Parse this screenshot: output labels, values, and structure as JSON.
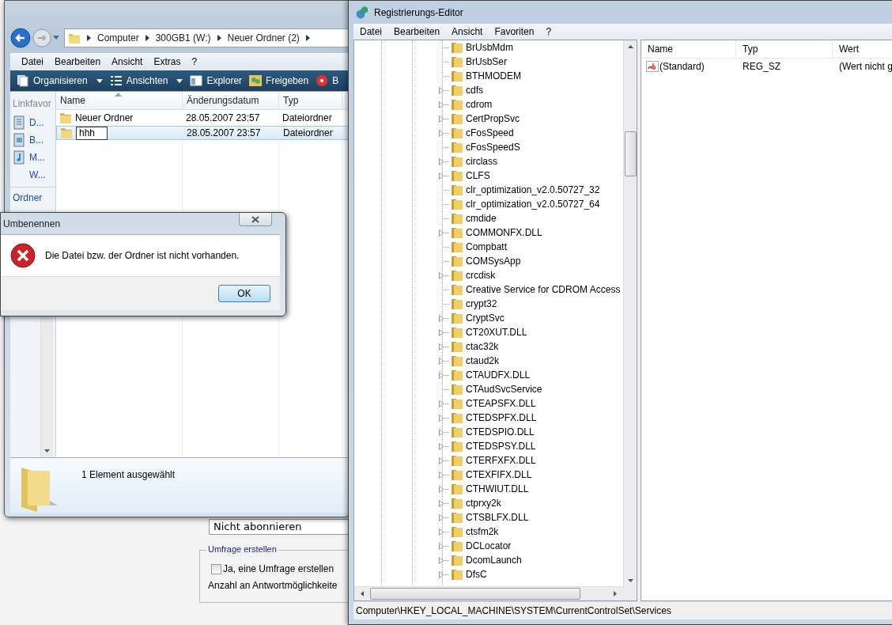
{
  "background_form": {
    "select_value": "Nicht abonnieren",
    "fieldset": {
      "legend": "Umfrage erstellen",
      "checkbox": {
        "label": "Ja, eine Umfrage erstellen",
        "checked": false
      },
      "text": "Anzahl an Antwortmöglichkeite"
    }
  },
  "explorer": {
    "breadcrumb": [
      "Computer",
      "300GB1 (W:)",
      "Neuer Ordner (2)"
    ],
    "menu": [
      "Datei",
      "Bearbeiten",
      "Ansicht",
      "Extras",
      "?"
    ],
    "toolbar": [
      {
        "label": "Organisieren",
        "kind": "organize",
        "dropdown": true
      },
      {
        "label": "Ansichten",
        "kind": "views",
        "dropdown": true
      },
      {
        "label": "Explorer",
        "kind": "explorer",
        "dropdown": false
      },
      {
        "label": "Freigeben",
        "kind": "share",
        "dropdown": false
      },
      {
        "label": "B",
        "kind": "burn",
        "dropdown": false
      }
    ],
    "nav": {
      "heading": "Linkfavor",
      "links": [
        {
          "label": "D...",
          "kind": "document"
        },
        {
          "label": "B...",
          "kind": "pictures"
        },
        {
          "label": "M...",
          "kind": "music"
        },
        {
          "label": "W...",
          "kind": "none"
        }
      ],
      "footer": "Ordner"
    },
    "columns": [
      {
        "label": "Name",
        "sorted": true
      },
      {
        "label": "Änderungsdatum",
        "sorted": false
      },
      {
        "label": "Typ",
        "sorted": false
      }
    ],
    "rows": [
      {
        "cells": [
          "Neuer Ordner",
          "28.05.2007 23:57",
          "Dateiordner"
        ],
        "selected": false,
        "editing": false
      },
      {
        "cells": [
          "hhh",
          "28.05.2007 23:57",
          "Dateiordner"
        ],
        "selected": true,
        "editing": true
      }
    ],
    "status": "1 Element ausgewählt"
  },
  "dialog": {
    "title": "Umbenennen",
    "message": "Die Datei bzw. der Ordner ist nicht vorhanden.",
    "button": "OK"
  },
  "registry": {
    "title": "Registrierungs-Editor",
    "menu": [
      "Datei",
      "Bearbeiten",
      "Ansicht",
      "Favoriten",
      "?"
    ],
    "tree": [
      {
        "label": "BrUsbMdm",
        "expandable": false
      },
      {
        "label": "BrUsbSer",
        "expandable": false
      },
      {
        "label": "BTHMODEM",
        "expandable": false
      },
      {
        "label": "cdfs",
        "expandable": true
      },
      {
        "label": "cdrom",
        "expandable": true
      },
      {
        "label": "CertPropSvc",
        "expandable": true
      },
      {
        "label": "cFosSpeed",
        "expandable": true
      },
      {
        "label": "cFosSpeedS",
        "expandable": false
      },
      {
        "label": "circlass",
        "expandable": true
      },
      {
        "label": "CLFS",
        "expandable": true
      },
      {
        "label": "clr_optimization_v2.0.50727_32",
        "expandable": false
      },
      {
        "label": "clr_optimization_v2.0.50727_64",
        "expandable": false
      },
      {
        "label": "cmdide",
        "expandable": false
      },
      {
        "label": "COMMONFX.DLL",
        "expandable": true
      },
      {
        "label": "Compbatt",
        "expandable": false
      },
      {
        "label": "COMSysApp",
        "expandable": false
      },
      {
        "label": "crcdisk",
        "expandable": true
      },
      {
        "label": "Creative Service for CDROM Access",
        "expandable": false
      },
      {
        "label": "crypt32",
        "expandable": false
      },
      {
        "label": "CryptSvc",
        "expandable": true
      },
      {
        "label": "CT20XUT.DLL",
        "expandable": true
      },
      {
        "label": "ctac32k",
        "expandable": true
      },
      {
        "label": "ctaud2k",
        "expandable": true
      },
      {
        "label": "CTAUDFX.DLL",
        "expandable": true
      },
      {
        "label": "CTAudSvcService",
        "expandable": false
      },
      {
        "label": "CTEAPSFX.DLL",
        "expandable": true
      },
      {
        "label": "CTEDSPFX.DLL",
        "expandable": true
      },
      {
        "label": "CTEDSPIO.DLL",
        "expandable": true
      },
      {
        "label": "CTEDSPSY.DLL",
        "expandable": true
      },
      {
        "label": "CTERFXFX.DLL",
        "expandable": true
      },
      {
        "label": "CTEXFIFX.DLL",
        "expandable": true
      },
      {
        "label": "CTHWIUT.DLL",
        "expandable": true
      },
      {
        "label": "ctprxy2k",
        "expandable": true
      },
      {
        "label": "CTSBLFX.DLL",
        "expandable": true
      },
      {
        "label": "ctsfm2k",
        "expandable": true
      },
      {
        "label": "DCLocator",
        "expandable": true
      },
      {
        "label": "DcomLaunch",
        "expandable": true
      },
      {
        "label": "DfsC",
        "expandable": true
      }
    ],
    "columns": [
      "Name",
      "Typ",
      "Wert"
    ],
    "values": [
      {
        "name": "(Standard)",
        "type": "REG_SZ",
        "data": "(Wert nicht g"
      }
    ],
    "status": "Computer\\HKEY_LOCAL_MACHINE\\SYSTEM\\CurrentControlSet\\Services"
  }
}
